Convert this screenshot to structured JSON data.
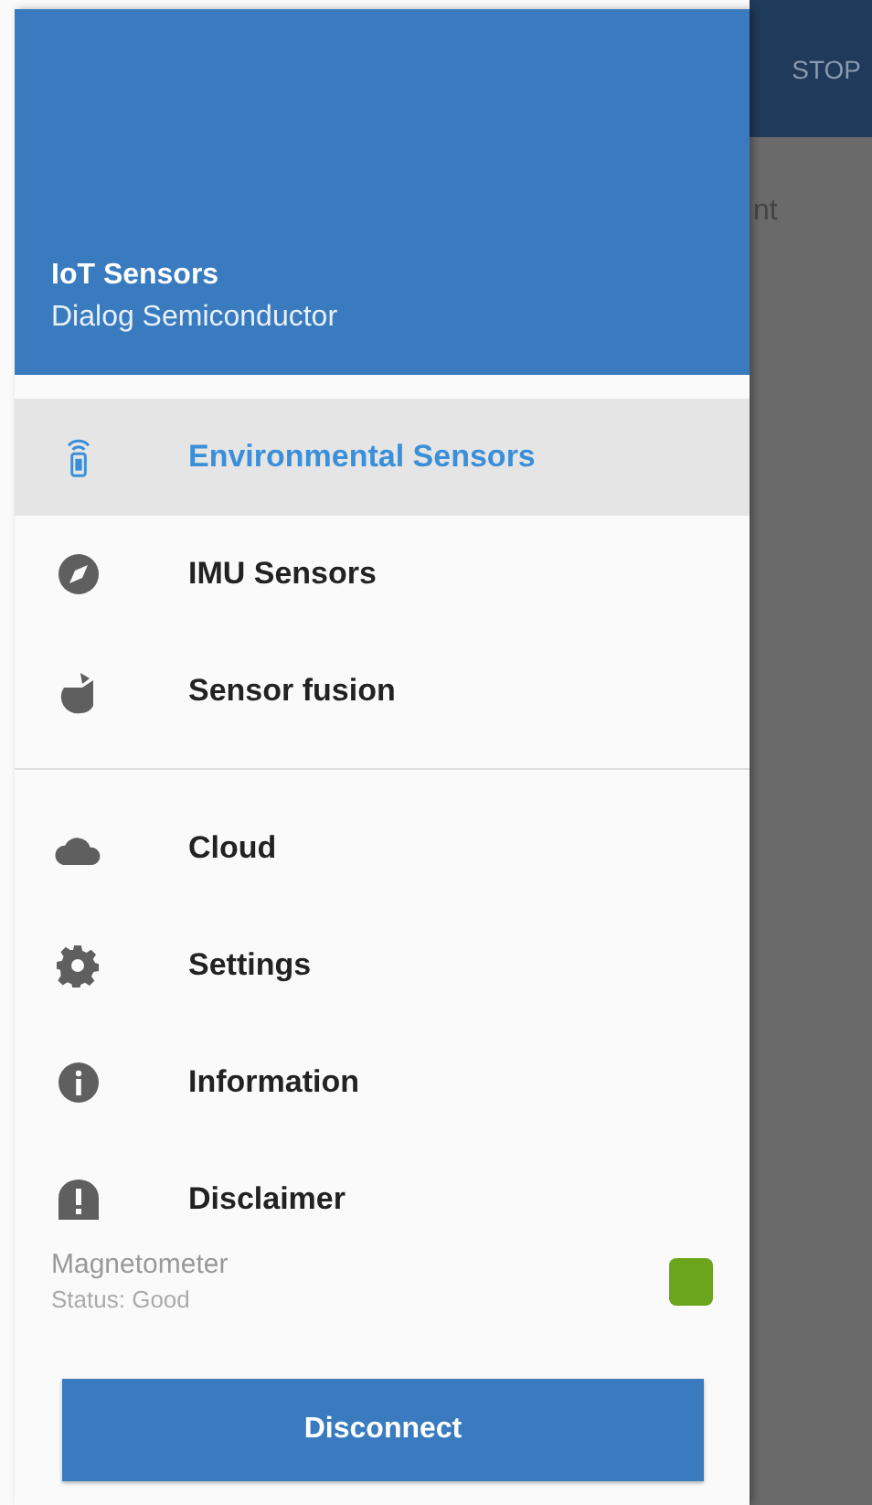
{
  "background": {
    "toolbar_action": "STOP",
    "partial_text": "nt"
  },
  "drawer": {
    "header": {
      "title": "IoT Sensors",
      "subtitle": "Dialog Semiconductor"
    },
    "sections": [
      {
        "items": [
          {
            "kind": "sensor",
            "label": "Environmental Sensors",
            "selected": true
          },
          {
            "kind": "compass",
            "label": "IMU Sensors",
            "selected": false
          },
          {
            "kind": "fusion",
            "label": "Sensor fusion",
            "selected": false
          }
        ]
      },
      {
        "items": [
          {
            "kind": "cloud",
            "label": "Cloud",
            "selected": false
          },
          {
            "kind": "gear",
            "label": "Settings",
            "selected": false
          },
          {
            "kind": "info",
            "label": "Information",
            "selected": false
          },
          {
            "kind": "warning",
            "label": "Disclaimer",
            "selected": false
          }
        ]
      }
    ],
    "sensor_status": {
      "name": "Magnetometer",
      "status": "Status: Good",
      "color": "#6aa51c"
    },
    "button": "Disconnect"
  }
}
